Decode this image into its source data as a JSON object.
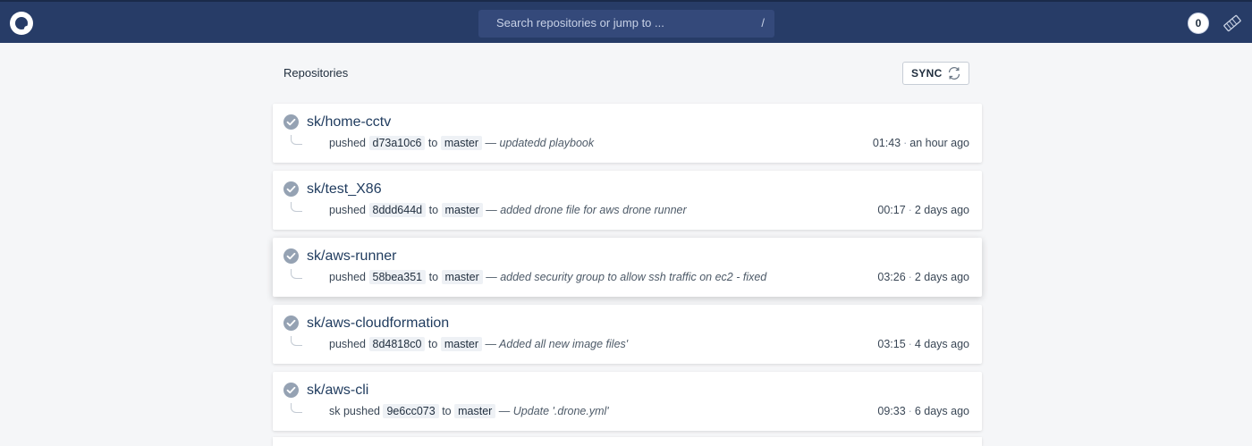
{
  "header": {
    "search_placeholder": "Search repositories or jump to ...",
    "search_shortcut": "/",
    "notification_count": "0"
  },
  "page": {
    "title": "Repositories",
    "sync_label": "SYNC"
  },
  "repos": [
    {
      "name": "sk/home-cctv",
      "actor": "",
      "action": "pushed",
      "sha": "d73a10c6",
      "to": "to",
      "branch": "master",
      "message": "— updatedd playbook",
      "duration": "01:43",
      "ago": "an hour ago"
    },
    {
      "name": "sk/test_X86",
      "actor": "",
      "action": "pushed",
      "sha": "8ddd644d",
      "to": "to",
      "branch": "master",
      "message": "— added drone file for aws drone runner",
      "duration": "00:17",
      "ago": "2 days ago"
    },
    {
      "name": "sk/aws-runner",
      "actor": "",
      "action": "pushed",
      "sha": "58bea351",
      "to": "to",
      "branch": "master",
      "message": "— added security group to allow ssh traffic on ec2 - fixed",
      "duration": "03:26",
      "ago": "2 days ago"
    },
    {
      "name": "sk/aws-cloudformation",
      "actor": "",
      "action": "pushed",
      "sha": "8d4818c0",
      "to": "to",
      "branch": "master",
      "message": "— Added all new image files'",
      "duration": "03:15",
      "ago": "4 days ago"
    },
    {
      "name": "sk/aws-cli",
      "actor": "sk",
      "action": "pushed",
      "sha": "9e6cc073",
      "to": "to",
      "branch": "master",
      "message": "— Update '.drone.yml'",
      "duration": "09:33",
      "ago": "6 days ago"
    }
  ],
  "colors": {
    "topbar": "#273c67",
    "search_bg": "#34497a",
    "status_success": "#95a2b3"
  },
  "icons": {
    "logo": "drone-logo-icon",
    "sync": "refresh-icon",
    "status": "check-circle-icon",
    "avatar": "user-avatar-icon"
  }
}
